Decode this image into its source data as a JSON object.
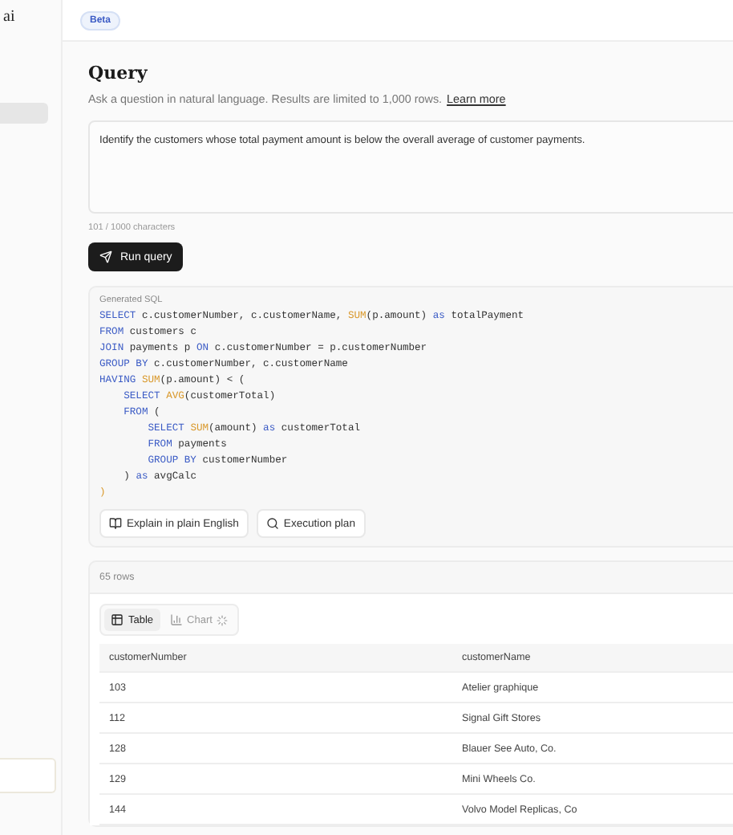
{
  "sidebar": {
    "brand": "ai",
    "items": [
      {
        "selected": true
      }
    ]
  },
  "header": {
    "badge": "Beta"
  },
  "query": {
    "title": "Query",
    "subtitle": "Ask a question in natural language. Results are limited to 1,000 rows.",
    "link": "Learn more",
    "input": "Identify the customers whose total payment amount is below the overall average of customer payments.",
    "char_count": "101 / 1000 characters",
    "run_button": "Run query"
  },
  "sql": {
    "label": "Generated SQL",
    "lines": [
      [
        {
          "t": "SELECT",
          "kind": "keyword"
        },
        {
          "t": " c.customerNumber, c.customerName, ",
          "kind": "plain"
        },
        {
          "t": "SUM",
          "kind": "function"
        },
        {
          "t": "(p.amount) ",
          "kind": "plain"
        },
        {
          "t": "as",
          "kind": "keyword"
        },
        {
          "t": " totalPayment",
          "kind": "plain"
        }
      ],
      [
        {
          "t": "FROM",
          "kind": "keyword"
        },
        {
          "t": " customers c",
          "kind": "plain"
        }
      ],
      [
        {
          "t": "JOIN",
          "kind": "keyword"
        },
        {
          "t": " payments p ",
          "kind": "plain"
        },
        {
          "t": "ON",
          "kind": "keyword"
        },
        {
          "t": " c.customerNumber = p.customerNumber",
          "kind": "plain"
        }
      ],
      [
        {
          "t": "GROUP BY",
          "kind": "keyword"
        },
        {
          "t": " c.customerNumber, c.customerName",
          "kind": "plain"
        }
      ],
      [
        {
          "t": "HAVING ",
          "kind": "keyword"
        },
        {
          "t": "SUM",
          "kind": "function"
        },
        {
          "t": "(p.amount) < (",
          "kind": "plain"
        }
      ],
      [
        {
          "t": "    SELECT ",
          "kind": "keyword"
        },
        {
          "t": "AVG",
          "kind": "function"
        },
        {
          "t": "(customerTotal)",
          "kind": "plain"
        }
      ],
      [
        {
          "t": "    FROM",
          "kind": "keyword"
        },
        {
          "t": " (",
          "kind": "plain"
        }
      ],
      [
        {
          "t": "        SELECT ",
          "kind": "keyword"
        },
        {
          "t": "SUM",
          "kind": "function"
        },
        {
          "t": "(amount) ",
          "kind": "plain"
        },
        {
          "t": "as",
          "kind": "keyword"
        },
        {
          "t": " customerTotal",
          "kind": "plain"
        }
      ],
      [
        {
          "t": "        FROM",
          "kind": "keyword"
        },
        {
          "t": " payments",
          "kind": "plain"
        }
      ],
      [
        {
          "t": "        GROUP BY",
          "kind": "keyword"
        },
        {
          "t": " customerNumber",
          "kind": "plain"
        }
      ],
      [
        {
          "t": "    ) ",
          "kind": "plain"
        },
        {
          "t": "as",
          "kind": "keyword"
        },
        {
          "t": " avgCalc",
          "kind": "plain"
        }
      ],
      [
        {
          "t": ")",
          "kind": "function"
        }
      ]
    ],
    "buttons": [
      {
        "label": "Explain in plain English",
        "kind": "book"
      },
      {
        "label": "Execution plan",
        "kind": "search"
      }
    ]
  },
  "results": {
    "count": "65 rows",
    "tabs": [
      {
        "label": "Table",
        "selected": true,
        "kind": "table"
      },
      {
        "label": "Chart",
        "selected": false,
        "kind": "chart"
      }
    ],
    "columns": [
      "customerNumber",
      "customerName"
    ],
    "rows": [
      [
        "103",
        "Atelier graphique"
      ],
      [
        "112",
        "Signal Gift Stores"
      ],
      [
        "128",
        "Blauer See Auto, Co."
      ],
      [
        "129",
        "Mini Wheels Co."
      ],
      [
        "144",
        "Volvo Model Replicas, Co"
      ]
    ]
  }
}
